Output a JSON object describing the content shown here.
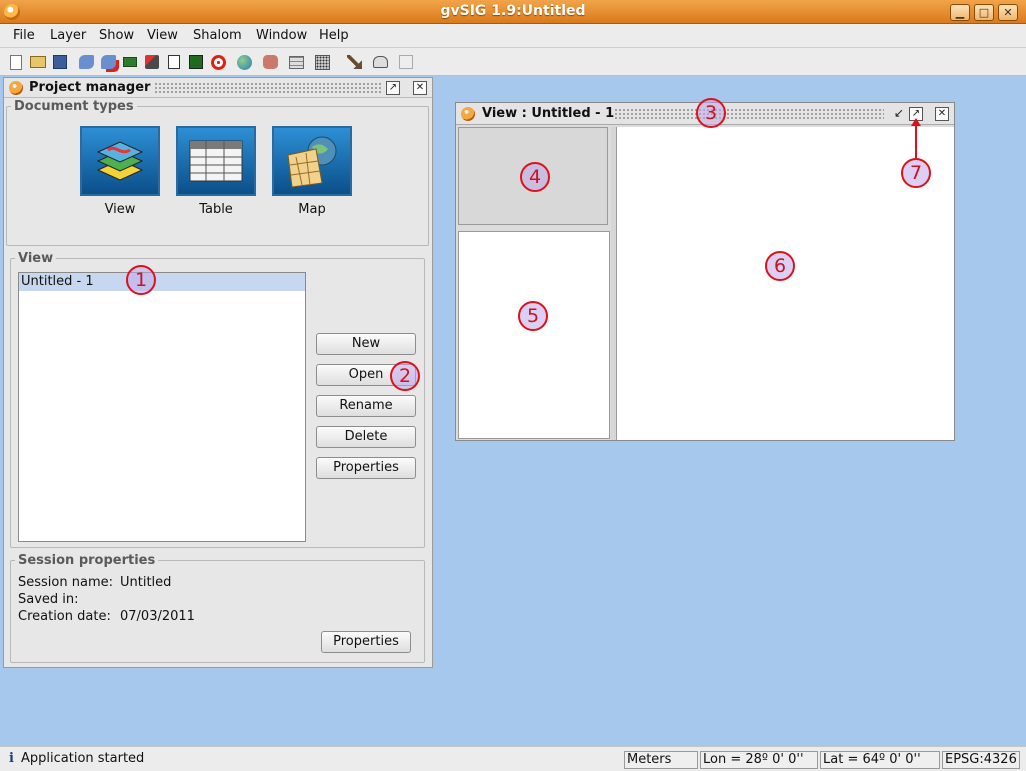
{
  "window": {
    "title": "gvSIG 1.9:Untitled",
    "min_icon": "minimize-icon",
    "max_icon": "maximize-icon",
    "close_icon": "close-icon"
  },
  "menu": [
    "File",
    "Layer",
    "Show",
    "View",
    "Shalom",
    "Window",
    "Help"
  ],
  "toolbar": {
    "icons": [
      "new-project-icon",
      "open-project-icon",
      "save-project-icon",
      "add-layer-icon",
      "remove-layer-icon",
      "extension-icon",
      "brush-icon",
      "edit-icon",
      "terminal-icon",
      "target-icon",
      "globe-icon",
      "tools-icon",
      "table-icon",
      "grid-icon",
      "hammer-icon",
      "preview-icon",
      "export-icon"
    ]
  },
  "project_manager": {
    "title": "Project manager",
    "doc_types_legend": "Document types",
    "doc_types": [
      "View",
      "Table",
      "Map"
    ],
    "section_legend": "View",
    "list_items": [
      "Untitled - 1"
    ],
    "buttons": {
      "new": "New",
      "open": "Open",
      "rename": "Rename",
      "delete": "Delete",
      "properties": "Properties"
    },
    "session": {
      "legend": "Session properties",
      "name_label": "Session name:",
      "name_value": "Untitled",
      "saved_label": "Saved in:",
      "saved_value": "",
      "date_label": "Creation date:",
      "date_value": "07/03/2011",
      "properties_button": "Properties"
    }
  },
  "view_window": {
    "title": "View : Untitled - 1"
  },
  "callouts": [
    "1",
    "2",
    "3",
    "4",
    "5",
    "6",
    "7"
  ],
  "status_bar": {
    "message": "Application started",
    "units": "Meters",
    "lon": "Lon = 28º 0' 0''",
    "lat": "Lat = 64º 0' 0''",
    "epsg": "EPSG:4326"
  },
  "colors": {
    "titlebar": "#e48a2a",
    "desktop": "#a6c8ed",
    "callout_border": "#e0101a",
    "selected_row": "#c7d7ef"
  }
}
